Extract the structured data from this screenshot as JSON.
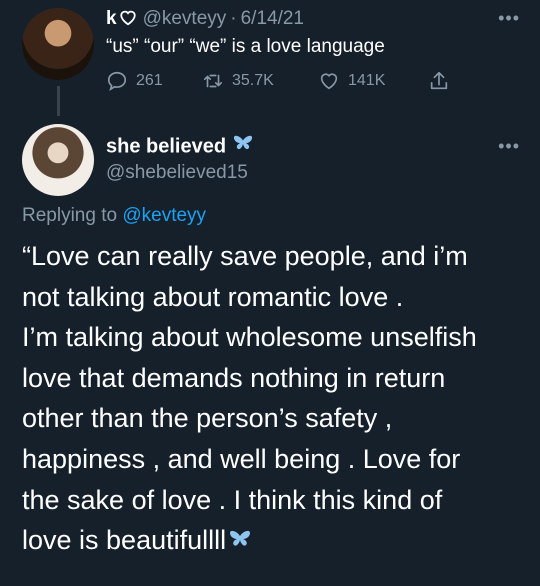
{
  "parent_tweet": {
    "display_name": "k",
    "handle": "@kevteyy",
    "date": "6/14/21",
    "text": "“us” “our” “we” is a love language",
    "replies": "261",
    "retweets": "35.7K",
    "likes": "141K"
  },
  "reply_tweet": {
    "display_name": "she believed",
    "handle": "@shebelieved15",
    "replying_label": "Replying to",
    "replying_handle": "@kevteyy",
    "text": "“Love can really save people, and i’m\nnot talking about romantic love .\nI’m talking about wholesome unselfish\nlove that demands nothing in return\nother than the person’s safety ,\nhappiness , and well being . Love for\nthe sake of love . I think this kind of\nlove is beautifullll"
  },
  "colors": {
    "background": "#15202b",
    "secondary_text": "#8899a6",
    "link": "#1da1f2",
    "butterfly": "#8ec5f0"
  },
  "icons": [
    "heart-outline-icon",
    "reply-icon",
    "retweet-icon",
    "like-icon",
    "share-icon",
    "more-icon",
    "butterfly-icon"
  ]
}
